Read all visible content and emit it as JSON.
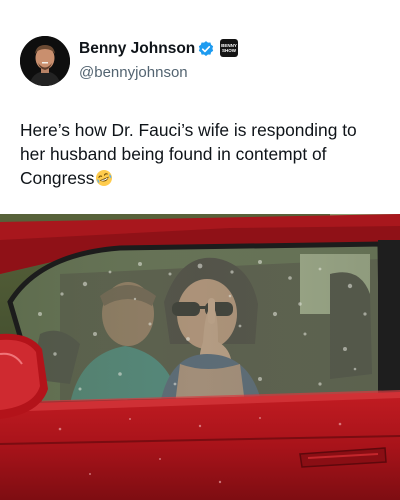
{
  "post": {
    "author": {
      "name": "Benny Johnson",
      "handle": "@bennyjohnson",
      "verified_icon": "verified-checkmark-icon",
      "affiliate_badge_text": "Benny Show"
    },
    "text": "Here’s how Dr. Fauci’s wife is responding to her husband being found in contempt of Congress",
    "text_emoji": "rolling-on-the-floor-laughing-emoji",
    "photo_subject": "woman in sunglasses inside red car through rain-covered window"
  },
  "colors": {
    "verified": "#1d9bf0",
    "handle": "#536471",
    "text": "#0f1419",
    "car_red": "#b3131a"
  }
}
